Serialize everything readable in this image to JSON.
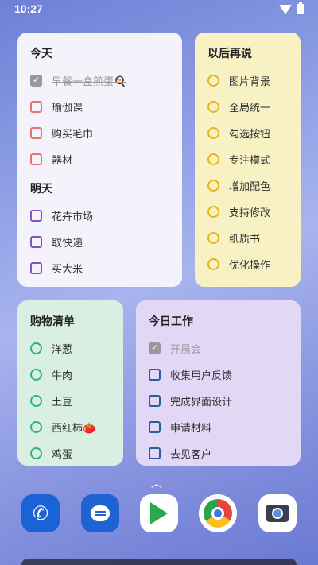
{
  "status": {
    "time": "10:27"
  },
  "today_card": {
    "title": "今天",
    "items": [
      {
        "label": "早餐一盒煎蛋🍳",
        "checked": true
      },
      {
        "label": "瑜伽课",
        "checked": false
      },
      {
        "label": "购买毛巾",
        "checked": false
      },
      {
        "label": "器材",
        "checked": false
      }
    ],
    "tomorrow_title": "明天",
    "tomorrow_items": [
      {
        "label": "花卉市场"
      },
      {
        "label": "取快递"
      },
      {
        "label": "买大米"
      }
    ]
  },
  "later_card": {
    "title": "以后再说",
    "items": [
      "图片背景",
      "全局统一",
      "勾选按钮",
      "专注模式",
      "增加配色",
      "支持修改",
      "纸质书",
      "优化操作"
    ]
  },
  "shopping_card": {
    "title": "购物清单",
    "items": [
      "洋葱",
      "牛肉",
      "土豆",
      "西红柿🍅",
      "鸡蛋"
    ]
  },
  "work_card": {
    "title": "今日工作",
    "items": [
      {
        "label": "开晨会",
        "checked": true
      },
      {
        "label": "收集用户反馈",
        "checked": false
      },
      {
        "label": "完成界面设计",
        "checked": false
      },
      {
        "label": "申请材料",
        "checked": false
      },
      {
        "label": "去见客户",
        "checked": false
      }
    ]
  },
  "dock": {
    "apps": [
      "phone-icon",
      "messages-icon",
      "play-store-icon",
      "chrome-icon",
      "camera-icon"
    ]
  },
  "colors": {
    "today": "#e0786c",
    "tomorrow": "#8651c7",
    "later": "#e6b51d",
    "shopping": "#2fb08a",
    "work": "#2d5c9a"
  }
}
